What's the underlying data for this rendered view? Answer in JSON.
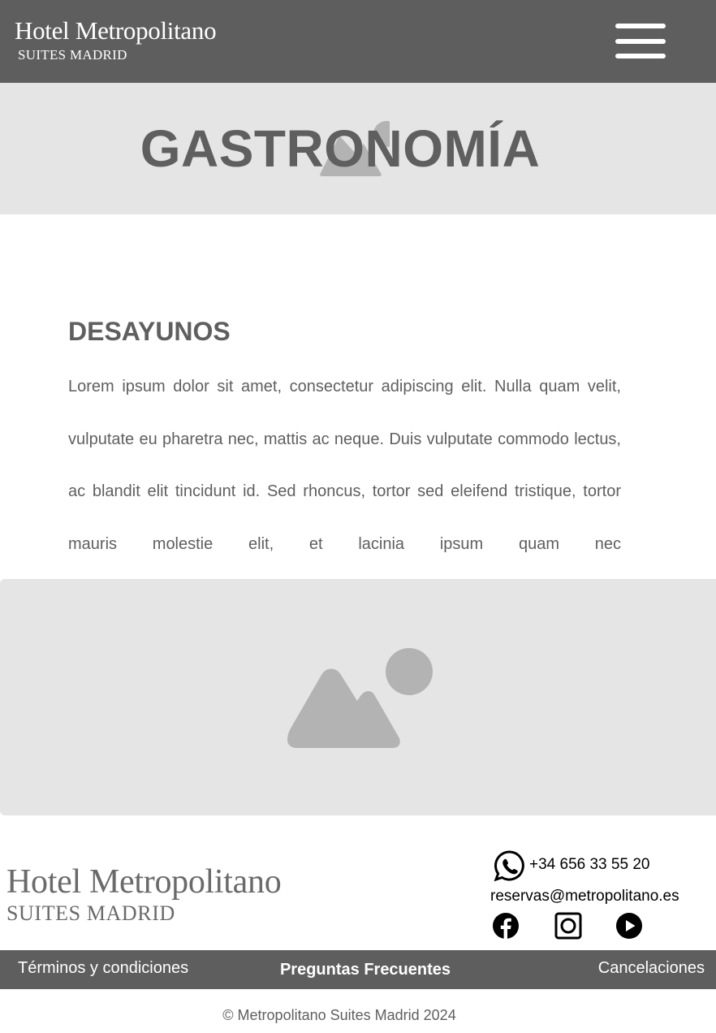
{
  "header": {
    "brand_title": "Hotel Metropolitano",
    "brand_subtitle": "SUITES MADRID",
    "menu_icon": "hamburger-menu-icon"
  },
  "hero": {
    "title": "GASTRONOMÍA",
    "background_icon": "image-placeholder-icon"
  },
  "section": {
    "heading": "DESAYUNOS",
    "body": "Lorem ipsum dolor sit amet, consectetur adipiscing elit. Nulla quam velit, vulputate eu pharetra nec, mattis ac neque. Duis vulputate commodo lectus, ac blandit elit tincidunt id. Sed rhoncus, tortor sed eleifend tristique, tortor mauris molestie elit, et lacinia ipsum quam nec",
    "image_icon": "image-placeholder-icon"
  },
  "footer": {
    "brand_title": "Hotel Metropolitano",
    "brand_subtitle": "SUITES MADRID",
    "phone": "+34 656 33 55 20",
    "email": "reservas@metropolitano.es",
    "social_icons": [
      "whatsapp-icon",
      "facebook-icon",
      "instagram-icon",
      "youtube-icon"
    ],
    "nav": {
      "terms": "Términos y condiciones",
      "faq": "Preguntas Frecuentes",
      "cancellations": "Cancelaciones"
    },
    "copyright": "© Metropolitano Suites Madrid 2024"
  },
  "colors": {
    "header_bg": "#5e5e5e",
    "placeholder_bg": "#e5e5e5",
    "text_gray": "#5f5f5f"
  }
}
